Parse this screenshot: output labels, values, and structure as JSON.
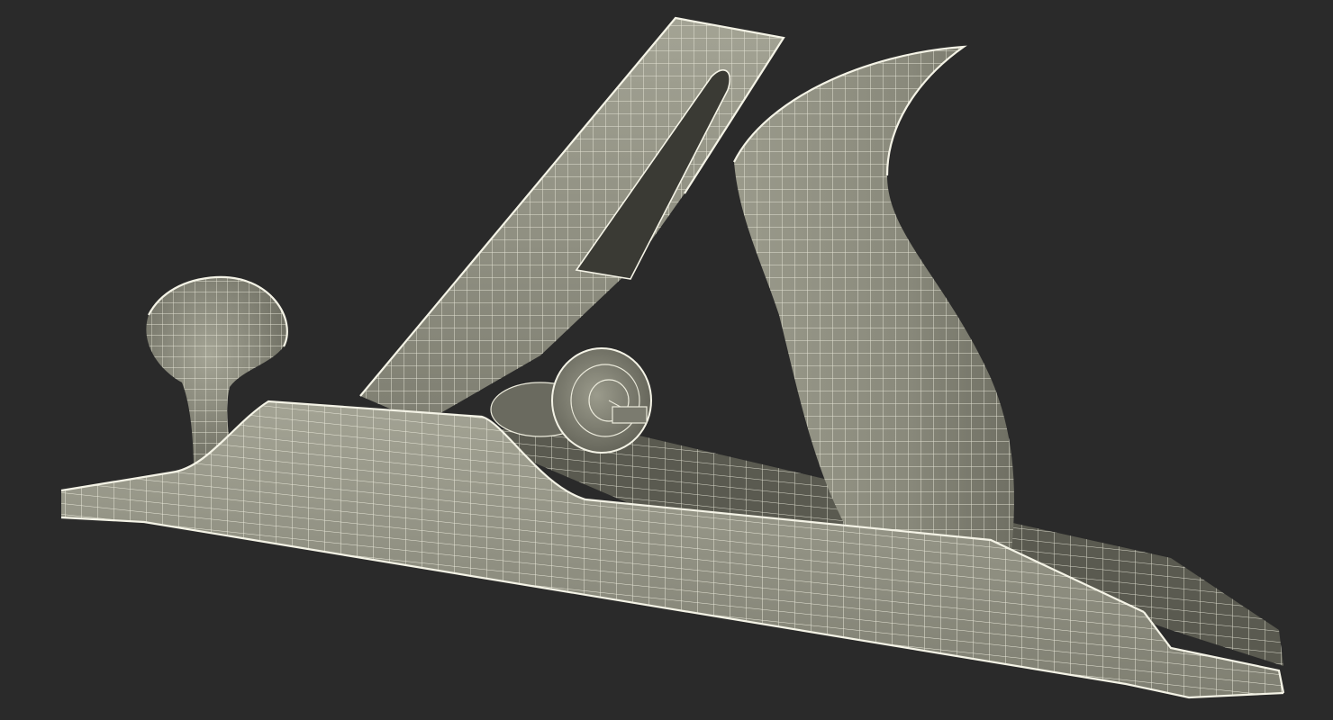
{
  "scene": {
    "subject_icon": "hand-plane-wireframe",
    "colors": {
      "background": "#2a2a2a",
      "surface": "#8a8a7c",
      "surface_light": "#a2a293",
      "surface_dark": "#5f5f54",
      "wire": "#ecebdc"
    }
  }
}
